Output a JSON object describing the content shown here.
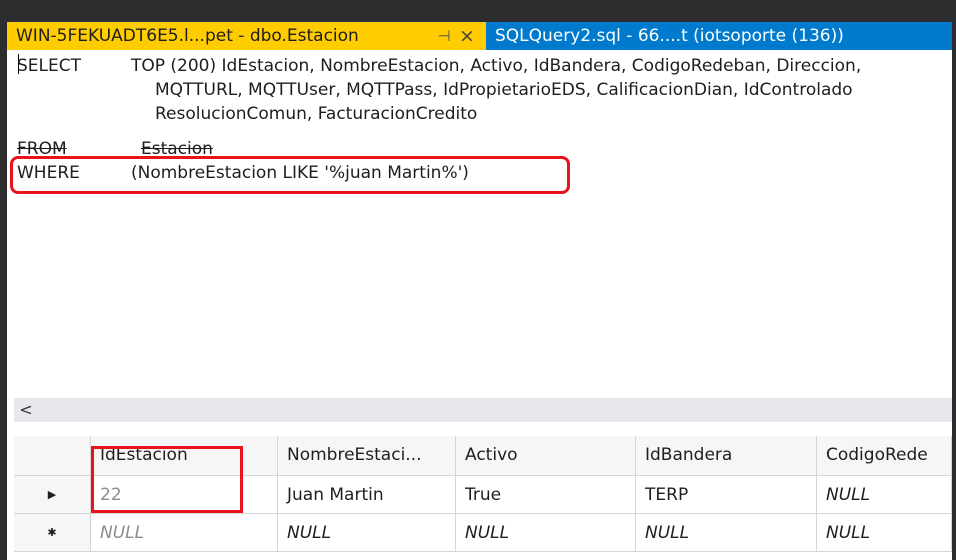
{
  "tabs": {
    "active": {
      "title": "WIN-5FEKUADT6E5.l...pet - dbo.Estacion",
      "pin_glyph": "⊣",
      "close_glyph": "×"
    },
    "inactive": {
      "title": "SQLQuery2.sql - 66....t (iotsoporte (136))"
    }
  },
  "sql": {
    "select_kw": "SELECT",
    "select_line1": "TOP (200) IdEstacion, NombreEstacion, Activo, IdBandera, CodigoRedeban, Direccion,",
    "select_line2": "MQTTURL, MQTTUser, MQTTPass, IdPropietarioEDS, CalificacionDian, IdControlado",
    "select_line3": "ResolucionComun, FacturacionCredito",
    "from_kw": "FROM",
    "from_table": "Estacion",
    "where_kw": "WHERE",
    "where_clause": "(NombreEstacion LIKE '%juan Martin%')"
  },
  "scrollbar": {
    "left_arrow": "<"
  },
  "grid": {
    "columns": [
      "IdEstacion",
      "NombreEstaci...",
      "Activo",
      "IdBandera",
      "CodigoRede"
    ],
    "rows": [
      {
        "marker": "▶",
        "cells": [
          "22",
          "Juan Martin",
          "True",
          "TERP",
          "NULL"
        ]
      },
      {
        "marker": "✱",
        "cells": [
          "NULL",
          "NULL",
          "NULL",
          "NULL",
          "NULL"
        ]
      }
    ]
  },
  "colors": {
    "active_tab": "#ffcc00",
    "inactive_tab": "#007acc",
    "highlight": "#e8131b",
    "ide_frame": "#2d2d30"
  }
}
